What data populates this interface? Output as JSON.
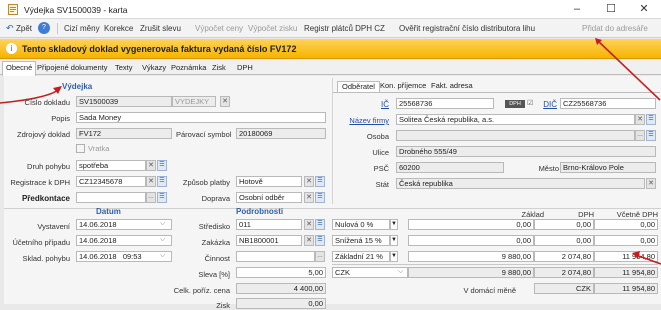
{
  "window": {
    "title": "Výdejka SV1500039 - karta",
    "min": "–",
    "max": "☐",
    "close": "✕"
  },
  "toolbar": {
    "back": "Zpět",
    "items": [
      "Cizí měny",
      "Korekce",
      "Zrušit slevu",
      "Výpočet ceny",
      "Výpočet zisku",
      "Registr plátců DPH CZ",
      "Ověřit registrační číslo distributora lihu",
      "Přidat do adresáře"
    ]
  },
  "banner": {
    "text": "Tento skladový doklad vygenerovala faktura vydaná číslo FV172"
  },
  "tabs": [
    "Obecné",
    "Připojené dokumenty",
    "Texty",
    "Výkazy",
    "Poznámka",
    "Zisk",
    "DPH"
  ],
  "vydejka": {
    "section": "Výdejka",
    "cislo_label": "Číslo dokladu",
    "cislo": "SV1500039",
    "cislo_type": "VYDEJKY",
    "popis_label": "Popis",
    "popis": "Sada Money",
    "zdroj_label": "Zdrojový doklad",
    "zdroj": "FV172",
    "parovaci_label": "Párovací symbol",
    "parovaci": "20180069",
    "vratka_label": "Vratka",
    "druh_label": "Druh pohybu",
    "druh": "spotřeba",
    "registrace_label": "Registrace k DPH",
    "registrace": "CZ12345678",
    "zpusob_label": "Způsob platby",
    "zpusob": "Hotově",
    "predkontace_label": "Předkontace",
    "doprava_label": "Doprava",
    "doprava": "Osobní odběr"
  },
  "odberatel": {
    "tabs": [
      "Odběratel",
      "Kon. příjemce",
      "Fakt. adresa"
    ],
    "ic_label": "IČ",
    "ic": "25568736",
    "dph_badge": "DPH",
    "dic_label": "DIČ",
    "dic": "CZ25568736",
    "firma_label": "Název firmy",
    "firma": "Solitea Česká republika, a.s.",
    "osoba_label": "Osoba",
    "ulice_label": "Ulice",
    "ulice": "Drobného 555/49",
    "psc_label": "PSČ",
    "psc": "60200",
    "mesto_label": "Město",
    "mesto": "Brno-Královo Pole",
    "stat_label": "Stát",
    "stat": "Česká republika"
  },
  "datum": {
    "section": "Datum",
    "vystaveni_label": "Vystavení",
    "vystaveni": "14.06.2018",
    "ucetni_label": "Účetního případu",
    "ucetni": "14.06.2018",
    "sklad_label": "Sklad. pohybu",
    "sklad_date": "14.06.2018",
    "sklad_time": "09:53"
  },
  "podrobnosti": {
    "section": "Podrobnosti",
    "stredisko_label": "Středisko",
    "stredisko": "011",
    "zakazka_label": "Zakázka",
    "zakazka": "NB1800001",
    "cinnost_label": "Činnost",
    "sleva_label": "Sleva [%]",
    "sleva": "5,00",
    "celk_label": "Celk. poříz. cena",
    "celk": "4 400,00",
    "zisk_label": "Zisk",
    "zisk": "0,00"
  },
  "dph": {
    "headers": [
      "Základ",
      "DPH",
      "Včetně DPH"
    ],
    "rows": [
      {
        "rate": "Nulová 0 %",
        "zaklad": "0,00",
        "dph": "0,00",
        "celkem": "0,00"
      },
      {
        "rate": "Snížená 15 %",
        "zaklad": "0,00",
        "dph": "0,00",
        "celkem": "0,00"
      },
      {
        "rate": "Základní 21 %",
        "zaklad": "9 880,00",
        "dph": "2 074,80",
        "celkem": "11 954,80"
      }
    ],
    "currency": "CZK",
    "total_zaklad": "9 880,00",
    "total_dph": "2 074,80",
    "total_celkem": "11 954,80",
    "domaci_label": "V domácí měně",
    "domaci_currency": "CZK",
    "domaci_total": "11 954,80"
  }
}
